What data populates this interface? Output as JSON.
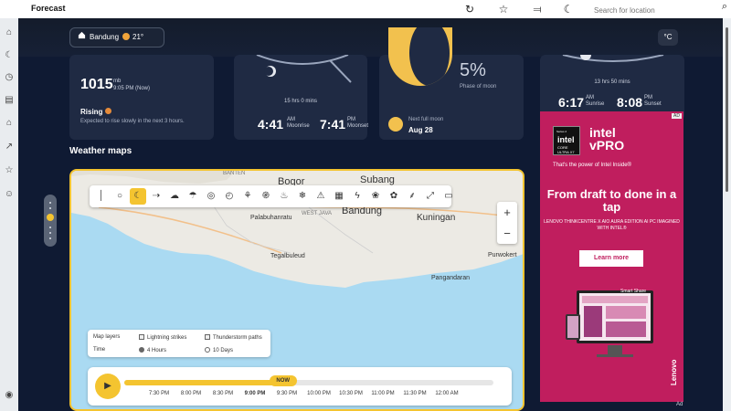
{
  "app": {
    "title": "Forecast"
  },
  "titlebar": {
    "icons": [
      "refresh-icon",
      "star-icon",
      "pin-icon",
      "moon-icon"
    ],
    "search_placeholder": "Search for location"
  },
  "rail": {
    "icons": [
      "home-icon",
      "weather-icon",
      "clock-icon",
      "calendar-icon",
      "house-icon",
      "chart-icon",
      "favorites-icon",
      "emoji-icon",
      "account-icon"
    ]
  },
  "location": {
    "name": "Bandung",
    "temp": "21°"
  },
  "unit": "°C",
  "pressure": {
    "value": "1015",
    "unit": "mb",
    "time": "9:05 PM (Now)",
    "trend": "Rising",
    "description": "Expected to rise slowly in the next 3 hours."
  },
  "moonrise": {
    "duration": "15 hrs 0 mins",
    "rise_time": "4:41",
    "rise_ampm": "AM",
    "rise_label": "Moonrise",
    "set_time": "7:41",
    "set_ampm": "PM",
    "set_label": "Moonset"
  },
  "moonphase": {
    "percent": "5%",
    "label": "Phase of moon",
    "next_label": "Next full moon",
    "next_date": "Aug 28"
  },
  "sun": {
    "duration": "13 hrs 50 mins",
    "rise_time": "6:17",
    "rise_ampm": "AM",
    "rise_label": "Sunrise",
    "set_time": "8:08",
    "set_ampm": "PM",
    "set_label": "Sunset"
  },
  "maps": {
    "section_title": "Weather maps",
    "places": [
      "BANTEN",
      "Bogor",
      "Subang",
      "Palabuhanratu",
      "WEST JAVA",
      "Bandung",
      "Kuningan",
      "Tegalbuleud",
      "Pangandaran",
      "Purwokert"
    ],
    "layers_label": "Map layers",
    "layer1": "Lightning strikes",
    "layer2": "Thunderstorm paths",
    "time_label": "Time",
    "time1": "4 Hours",
    "time2": "10 Days",
    "now_label": "NOW",
    "ticks": [
      "7:30 PM",
      "8:00 PM",
      "8:30 PM",
      "9:00 PM",
      "9:30 PM",
      "10:00 PM",
      "10:30 PM",
      "11:00 PM",
      "11:30 PM",
      "12:00 AM"
    ],
    "zoom_in": "+",
    "zoom_out": "−",
    "progress_fraction": 0.43
  },
  "ad": {
    "chip_series": "Series 2",
    "chip_brand": "intel",
    "chip_sub": "CORE ULTRA X7",
    "brand": "intel",
    "brand_sub": "vPRO",
    "tagline": "That's the power of Intel Inside®",
    "headline": "From draft to done in a tap",
    "subline": "LENOVO THINKCENTRE X AIO AURA EDITION AI PC IMAGINED WITH INTEL®",
    "cta": "Learn more",
    "badge": "Smart Share",
    "lenovo": "Lenovo",
    "label": "Ad",
    "tag": "AD"
  }
}
